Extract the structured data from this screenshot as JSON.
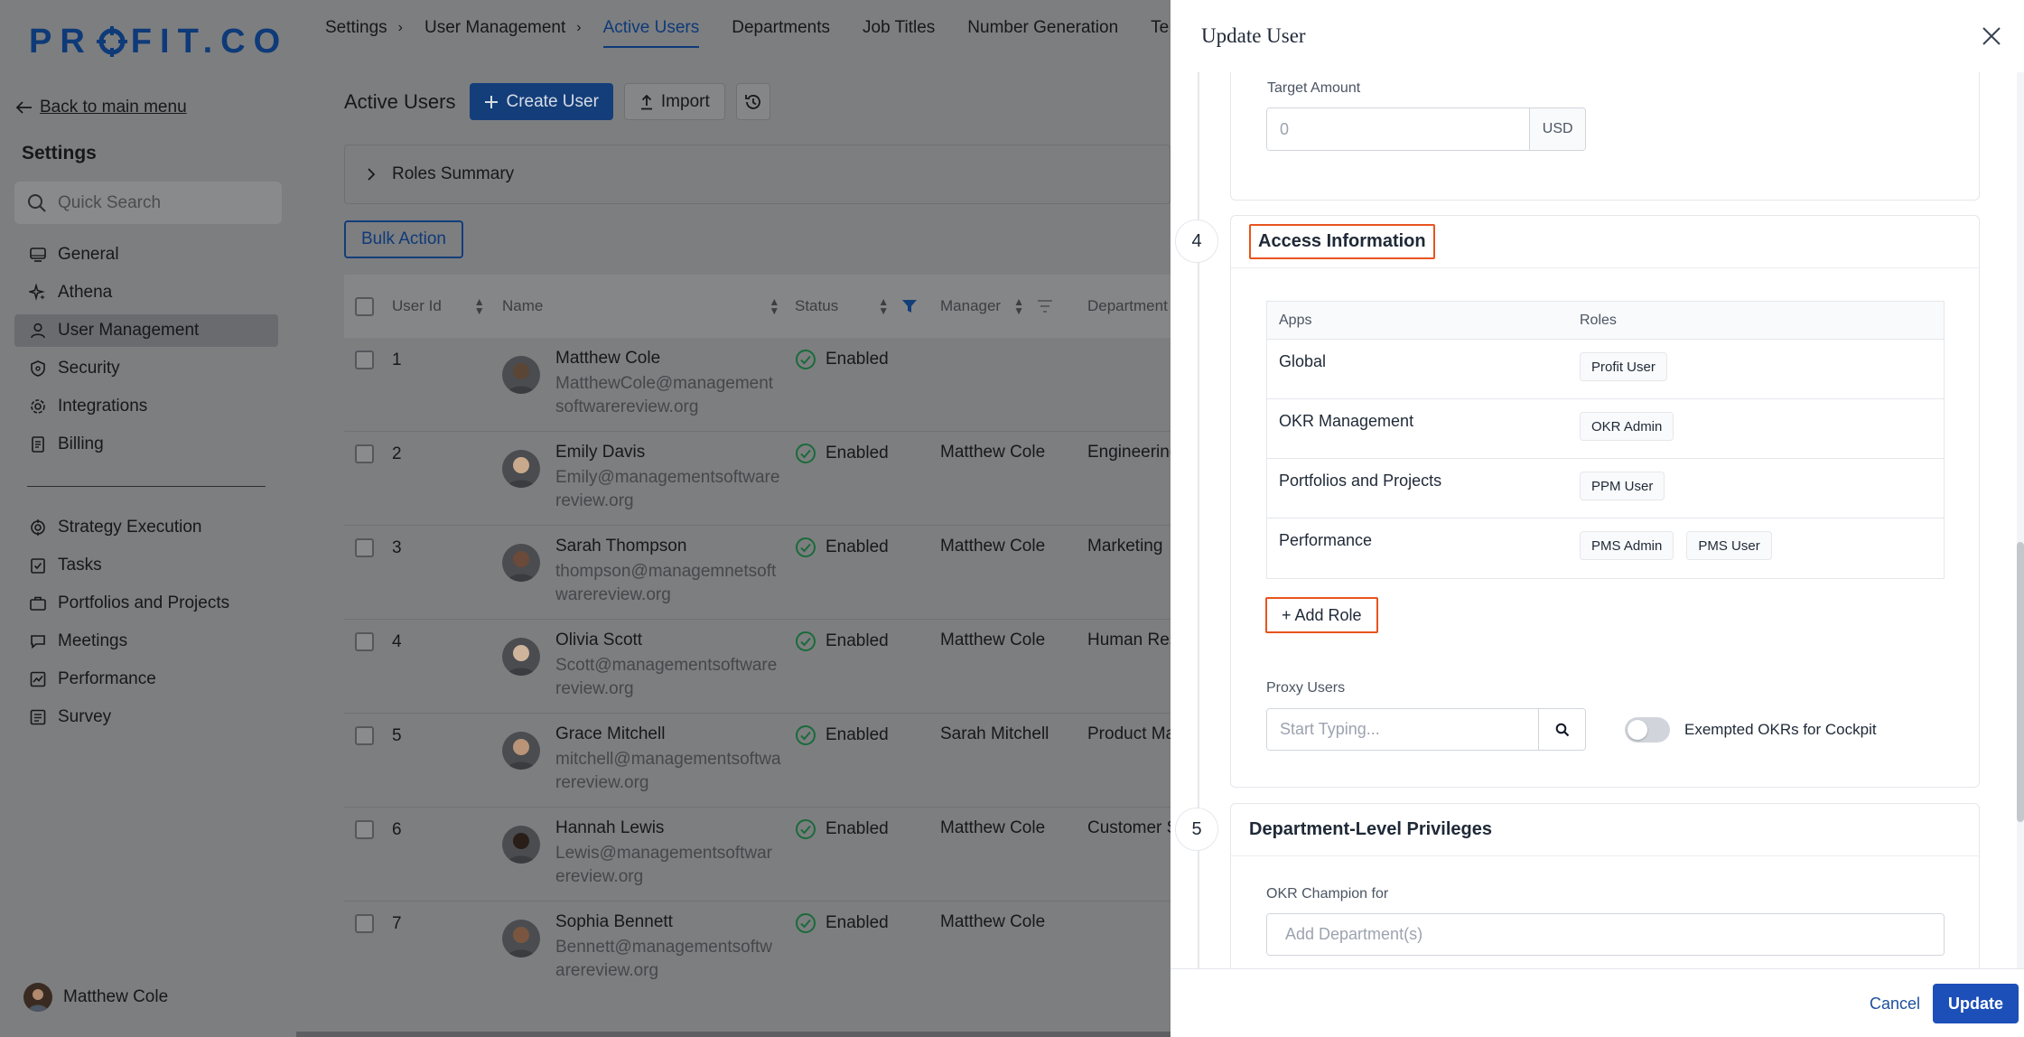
{
  "brand": {
    "logo_text_left": "PR",
    "logo_text_right": "FIT.CO",
    "color": "#0e3a78"
  },
  "sidebar": {
    "back_label": "Back to main menu",
    "heading": "Settings",
    "search_placeholder": "Quick Search",
    "group1": [
      {
        "label": "General",
        "icon": "monitor-icon"
      },
      {
        "label": "Athena",
        "icon": "sparkle-icon"
      },
      {
        "label": "User Management",
        "icon": "user-icon",
        "active": true
      },
      {
        "label": "Security",
        "icon": "shield-icon"
      },
      {
        "label": "Integrations",
        "icon": "gear-icon"
      },
      {
        "label": "Billing",
        "icon": "document-icon"
      }
    ],
    "group2": [
      {
        "label": "Strategy Execution",
        "icon": "target-icon"
      },
      {
        "label": "Tasks",
        "icon": "checklist-icon"
      },
      {
        "label": "Portfolios and Projects",
        "icon": "briefcase-icon"
      },
      {
        "label": "Meetings",
        "icon": "chat-icon"
      },
      {
        "label": "Performance",
        "icon": "chart-icon"
      },
      {
        "label": "Survey",
        "icon": "survey-icon"
      }
    ],
    "current_user": "Matthew Cole"
  },
  "topnav": {
    "breadcrumbs": [
      "Settings",
      "User Management"
    ],
    "tabs": [
      "Active Users",
      "Departments",
      "Job Titles",
      "Number Generation",
      "Te"
    ],
    "active_tab": "Active Users"
  },
  "main": {
    "title": "Active Users",
    "create_label": "Create User",
    "import_label": "Import",
    "roles_summary": "Roles Summary",
    "bulk_action": "Bulk Action",
    "columns": [
      "User Id",
      "Name",
      "Status",
      "Manager",
      "Department"
    ],
    "rows": [
      {
        "id": "1",
        "name": "Matthew Cole",
        "email": "MatthewCole@managementsoftwarereview.org",
        "status": "Enabled",
        "manager": "",
        "department": ""
      },
      {
        "id": "2",
        "name": "Emily Davis",
        "email": "Emily@managementsoftwarereview.org",
        "status": "Enabled",
        "manager": "Matthew Cole",
        "department": "Engineering"
      },
      {
        "id": "3",
        "name": "Sarah Thompson",
        "email": "thompson@managemnetsoftwarereview.org",
        "status": "Enabled",
        "manager": "Matthew Cole",
        "department": "Marketing"
      },
      {
        "id": "4",
        "name": "Olivia Scott",
        "email": "Scott@managementsoftwarereview.org",
        "status": "Enabled",
        "manager": "Matthew Cole",
        "department": "Human Reso"
      },
      {
        "id": "5",
        "name": "Grace Mitchell",
        "email": "mitchell@managementsoftwarereview.org",
        "status": "Enabled",
        "manager": "Sarah Mitchell",
        "department": "Product Ma"
      },
      {
        "id": "6",
        "name": "Hannah Lewis",
        "email": "Lewis@managementsoftwarereview.org",
        "status": "Enabled",
        "manager": "Matthew Cole",
        "department": "Customer S"
      },
      {
        "id": "7",
        "name": "Sophia Bennett",
        "email": "Bennett@managementsoftwarereview.org",
        "status": "Enabled",
        "manager": "Matthew Cole",
        "department": ""
      }
    ],
    "status_color": "#1a6b3a"
  },
  "drawer": {
    "title": "Update User",
    "target_amount_label": "Target Amount",
    "target_amount_placeholder": "0",
    "currency": "USD",
    "section4": {
      "number": "4",
      "title": "Access Information"
    },
    "roles_table": {
      "headers": [
        "Apps",
        "Roles"
      ],
      "rows": [
        {
          "app": "Global",
          "roles": [
            "Profit User"
          ]
        },
        {
          "app": "OKR Management",
          "roles": [
            "OKR Admin"
          ]
        },
        {
          "app": "Portfolios and Projects",
          "roles": [
            "PPM User"
          ]
        },
        {
          "app": "Performance",
          "roles": [
            "PMS Admin",
            "PMS User"
          ]
        }
      ]
    },
    "add_role_label": "+ Add Role",
    "proxy_users_label": "Proxy Users",
    "proxy_placeholder": "Start Typing...",
    "exempted_label": "Exempted OKRs for Cockpit",
    "exempted_on": false,
    "section5": {
      "number": "5",
      "title": "Department-Level Privileges"
    },
    "okr_champion_label": "OKR Champion for",
    "okr_champion_placeholder": "Add Department(s)",
    "cancel_label": "Cancel",
    "update_label": "Update",
    "highlight_color": "#e8541e",
    "primary_color": "#1d4fb8"
  }
}
